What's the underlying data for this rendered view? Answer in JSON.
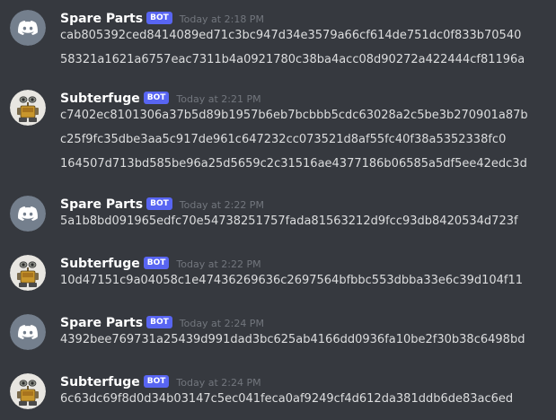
{
  "messages": [
    {
      "author": "Spare Parts",
      "avatar": "discord-logo",
      "badge": "BOT",
      "timestamp": "Today at 2:18 PM",
      "lines": [
        "cab805392ced8414089ed71c3bc947d34e3579a66cf614de751dc0f833b70540",
        "58321a1621a6757eac7311b4a0921780c38ba4acc08d90272a422444cf81196a"
      ]
    },
    {
      "author": "Subterfuge",
      "avatar": "robot",
      "badge": "BOT",
      "timestamp": "Today at 2:21 PM",
      "lines": [
        "c7402ec8101306a37b5d89b1957b6eb7bcbbb5cdc63028a2c5be3b270901a87b",
        "c25f9fc35dbe3aa5c917de961c647232cc073521d8af55fc40f38a5352338fc0",
        "164507d713bd585be96a25d5659c2c31516ae4377186b06585a5df5ee42edc3d"
      ]
    },
    {
      "author": "Spare Parts",
      "avatar": "discord-logo",
      "badge": "BOT",
      "timestamp": "Today at 2:22 PM",
      "lines": [
        "5a1b8bd091965edfc70e54738251757fada81563212d9fcc93db8420534d723f"
      ]
    },
    {
      "author": "Subterfuge",
      "avatar": "robot",
      "badge": "BOT",
      "timestamp": "Today at 2:22 PM",
      "lines": [
        "10d47151c9a04058c1e47436269636c2697564bfbbc553dbba33e6c39d104f11"
      ]
    },
    {
      "author": "Spare Parts",
      "avatar": "discord-logo",
      "badge": "BOT",
      "timestamp": "Today at 2:24 PM",
      "lines": [
        "4392bee769731a25439d991dad3bc625ab4166dd0936fa10be2f30b38c6498bd"
      ]
    },
    {
      "author": "Subterfuge",
      "avatar": "robot",
      "badge": "BOT",
      "timestamp": "Today at 2:24 PM",
      "lines": [
        "6c63dc69f8d0d34b03147c5ec041feca0af9249cf4d612da381ddb6de83ac6ed"
      ]
    }
  ]
}
